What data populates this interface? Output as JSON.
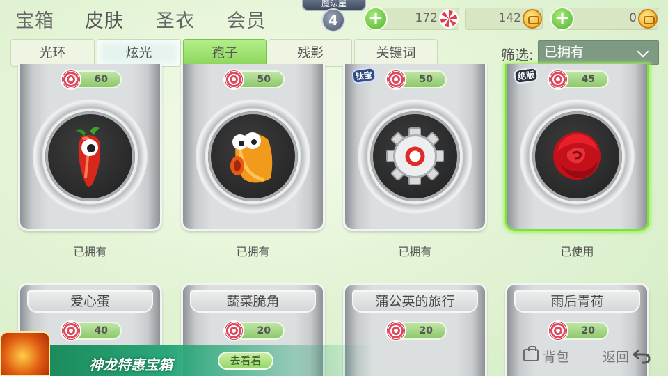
{
  "nav": {
    "tabs": [
      {
        "label": "宝箱"
      },
      {
        "label": "皮肤"
      },
      {
        "label": "圣衣"
      },
      {
        "label": "会员"
      }
    ],
    "active_tab": "皮肤"
  },
  "house": {
    "title": "魔法屋",
    "level": "4"
  },
  "currencies": {
    "candy": {
      "value": "172",
      "icon": "candy-icon"
    },
    "coin_bind": {
      "value": "142",
      "icon": "coin-icon"
    },
    "coin": {
      "value": "0",
      "icon": "coin-icon"
    }
  },
  "sub_tabs": [
    {
      "label": "光环"
    },
    {
      "label": "炫光"
    },
    {
      "label": "孢子"
    },
    {
      "label": "残影"
    },
    {
      "label": "关键词"
    }
  ],
  "active_sub_tab": "孢子",
  "filter": {
    "label": "筛选:",
    "value": "已拥有"
  },
  "cards_top": [
    {
      "price": "60",
      "item_icon": "red-chili-icon",
      "status": "已拥有",
      "badge": ""
    },
    {
      "price": "50",
      "item_icon": "orange-bird-icon",
      "status": "已拥有",
      "badge": ""
    },
    {
      "price": "50",
      "item_icon": "silver-gear-icon",
      "status": "已拥有",
      "badge": "钛宝"
    },
    {
      "price": "45",
      "item_icon": "red-rose-icon",
      "status": "已使用",
      "badge": "绝版"
    }
  ],
  "cards_bottom": [
    {
      "title": "爱心蛋",
      "price": "40"
    },
    {
      "title": "蔬菜脆角",
      "price": "20"
    },
    {
      "title": "蒲公英的旅行",
      "price": "20"
    },
    {
      "title": "雨后青荷",
      "price": "20"
    }
  ],
  "promo": {
    "text": "神龙特惠宝箱",
    "button": "去看看"
  },
  "footer": {
    "bag_label": "背包",
    "back_label": "返回"
  },
  "colors": {
    "accent_green": "#8bd55c",
    "selected_border": "#7de03f",
    "candy_red": "#e0495c"
  }
}
